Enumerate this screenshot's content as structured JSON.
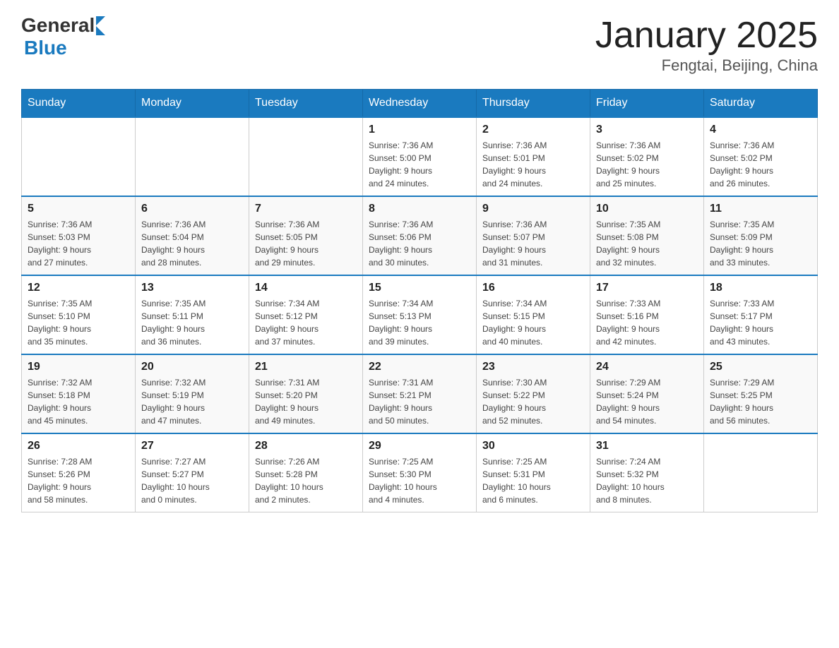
{
  "header": {
    "logo_general": "General",
    "logo_blue": "Blue",
    "title": "January 2025",
    "subtitle": "Fengtai, Beijing, China"
  },
  "days_of_week": [
    "Sunday",
    "Monday",
    "Tuesday",
    "Wednesday",
    "Thursday",
    "Friday",
    "Saturday"
  ],
  "weeks": [
    {
      "days": [
        {
          "number": "",
          "info": ""
        },
        {
          "number": "",
          "info": ""
        },
        {
          "number": "",
          "info": ""
        },
        {
          "number": "1",
          "info": "Sunrise: 7:36 AM\nSunset: 5:00 PM\nDaylight: 9 hours\nand 24 minutes."
        },
        {
          "number": "2",
          "info": "Sunrise: 7:36 AM\nSunset: 5:01 PM\nDaylight: 9 hours\nand 24 minutes."
        },
        {
          "number": "3",
          "info": "Sunrise: 7:36 AM\nSunset: 5:02 PM\nDaylight: 9 hours\nand 25 minutes."
        },
        {
          "number": "4",
          "info": "Sunrise: 7:36 AM\nSunset: 5:02 PM\nDaylight: 9 hours\nand 26 minutes."
        }
      ]
    },
    {
      "days": [
        {
          "number": "5",
          "info": "Sunrise: 7:36 AM\nSunset: 5:03 PM\nDaylight: 9 hours\nand 27 minutes."
        },
        {
          "number": "6",
          "info": "Sunrise: 7:36 AM\nSunset: 5:04 PM\nDaylight: 9 hours\nand 28 minutes."
        },
        {
          "number": "7",
          "info": "Sunrise: 7:36 AM\nSunset: 5:05 PM\nDaylight: 9 hours\nand 29 minutes."
        },
        {
          "number": "8",
          "info": "Sunrise: 7:36 AM\nSunset: 5:06 PM\nDaylight: 9 hours\nand 30 minutes."
        },
        {
          "number": "9",
          "info": "Sunrise: 7:36 AM\nSunset: 5:07 PM\nDaylight: 9 hours\nand 31 minutes."
        },
        {
          "number": "10",
          "info": "Sunrise: 7:35 AM\nSunset: 5:08 PM\nDaylight: 9 hours\nand 32 minutes."
        },
        {
          "number": "11",
          "info": "Sunrise: 7:35 AM\nSunset: 5:09 PM\nDaylight: 9 hours\nand 33 minutes."
        }
      ]
    },
    {
      "days": [
        {
          "number": "12",
          "info": "Sunrise: 7:35 AM\nSunset: 5:10 PM\nDaylight: 9 hours\nand 35 minutes."
        },
        {
          "number": "13",
          "info": "Sunrise: 7:35 AM\nSunset: 5:11 PM\nDaylight: 9 hours\nand 36 minutes."
        },
        {
          "number": "14",
          "info": "Sunrise: 7:34 AM\nSunset: 5:12 PM\nDaylight: 9 hours\nand 37 minutes."
        },
        {
          "number": "15",
          "info": "Sunrise: 7:34 AM\nSunset: 5:13 PM\nDaylight: 9 hours\nand 39 minutes."
        },
        {
          "number": "16",
          "info": "Sunrise: 7:34 AM\nSunset: 5:15 PM\nDaylight: 9 hours\nand 40 minutes."
        },
        {
          "number": "17",
          "info": "Sunrise: 7:33 AM\nSunset: 5:16 PM\nDaylight: 9 hours\nand 42 minutes."
        },
        {
          "number": "18",
          "info": "Sunrise: 7:33 AM\nSunset: 5:17 PM\nDaylight: 9 hours\nand 43 minutes."
        }
      ]
    },
    {
      "days": [
        {
          "number": "19",
          "info": "Sunrise: 7:32 AM\nSunset: 5:18 PM\nDaylight: 9 hours\nand 45 minutes."
        },
        {
          "number": "20",
          "info": "Sunrise: 7:32 AM\nSunset: 5:19 PM\nDaylight: 9 hours\nand 47 minutes."
        },
        {
          "number": "21",
          "info": "Sunrise: 7:31 AM\nSunset: 5:20 PM\nDaylight: 9 hours\nand 49 minutes."
        },
        {
          "number": "22",
          "info": "Sunrise: 7:31 AM\nSunset: 5:21 PM\nDaylight: 9 hours\nand 50 minutes."
        },
        {
          "number": "23",
          "info": "Sunrise: 7:30 AM\nSunset: 5:22 PM\nDaylight: 9 hours\nand 52 minutes."
        },
        {
          "number": "24",
          "info": "Sunrise: 7:29 AM\nSunset: 5:24 PM\nDaylight: 9 hours\nand 54 minutes."
        },
        {
          "number": "25",
          "info": "Sunrise: 7:29 AM\nSunset: 5:25 PM\nDaylight: 9 hours\nand 56 minutes."
        }
      ]
    },
    {
      "days": [
        {
          "number": "26",
          "info": "Sunrise: 7:28 AM\nSunset: 5:26 PM\nDaylight: 9 hours\nand 58 minutes."
        },
        {
          "number": "27",
          "info": "Sunrise: 7:27 AM\nSunset: 5:27 PM\nDaylight: 10 hours\nand 0 minutes."
        },
        {
          "number": "28",
          "info": "Sunrise: 7:26 AM\nSunset: 5:28 PM\nDaylight: 10 hours\nand 2 minutes."
        },
        {
          "number": "29",
          "info": "Sunrise: 7:25 AM\nSunset: 5:30 PM\nDaylight: 10 hours\nand 4 minutes."
        },
        {
          "number": "30",
          "info": "Sunrise: 7:25 AM\nSunset: 5:31 PM\nDaylight: 10 hours\nand 6 minutes."
        },
        {
          "number": "31",
          "info": "Sunrise: 7:24 AM\nSunset: 5:32 PM\nDaylight: 10 hours\nand 8 minutes."
        },
        {
          "number": "",
          "info": ""
        }
      ]
    }
  ]
}
